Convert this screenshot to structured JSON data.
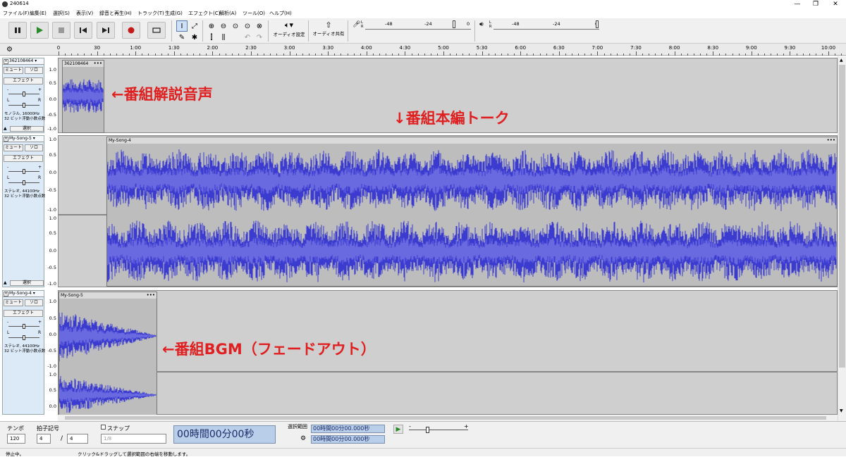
{
  "window": {
    "title": "240614",
    "controls": [
      "—",
      "❐",
      "✕"
    ]
  },
  "menu": [
    "ファイル(F)",
    "編集(E)",
    "選択(S)",
    "表示(V)",
    "録音と再生(H)",
    "トラック(T)",
    "生成(G)",
    "エフェクト(C)",
    "解析(A)",
    "ツール(O)",
    "ヘルプ(H)"
  ],
  "toolbar": {
    "audio_setup": "オーディオ設定",
    "share_audio": "オーディオ共有",
    "rec_meter_ticks": [
      "-48",
      "-24",
      "0"
    ],
    "play_meter_ticks": [
      "-48",
      "-24",
      "0"
    ],
    "meter_channels": [
      "L",
      "R"
    ]
  },
  "ruler": {
    "labels": [
      "0",
      "30",
      "1:00",
      "1:30",
      "2:00",
      "2:30",
      "3:00",
      "3:30",
      "4:00",
      "4:30",
      "5:00",
      "5:30",
      "6:00",
      "6:30",
      "7:00",
      "7:30",
      "8:00",
      "8:30",
      "9:00",
      "9:30",
      "10:00"
    ]
  },
  "tracks": [
    {
      "name": "362108464",
      "mute": "ミュート",
      "solo": "ソロ",
      "effects": "エフェクト",
      "gain": {
        "minus": "-",
        "plus": "+"
      },
      "pan": {
        "left": "L",
        "right": "R"
      },
      "info_lines": [
        "モノラル, 16000Hz",
        "32 ビット浮動小数点数"
      ],
      "select": "選択",
      "scale": [
        "1.0",
        "0.5",
        "0.0",
        "-0.5",
        "-1.0"
      ],
      "clips": [
        {
          "name": "362108464"
        }
      ]
    },
    {
      "name": "My-Song-5",
      "mute": "ミュート",
      "solo": "ソロ",
      "effects": "エフェクト",
      "gain": {
        "minus": "-",
        "plus": "+"
      },
      "pan": {
        "left": "L",
        "right": "R"
      },
      "info_lines": [
        "ステレオ, 44100Hz",
        "32 ビット浮動小数点数"
      ],
      "select": "選択",
      "scale": [
        "1.0",
        "0.5",
        "0.0",
        "-0.5",
        "-1.0"
      ],
      "clips": [
        {
          "name": "My-Song-4"
        }
      ]
    },
    {
      "name": "My-Song-4",
      "mute": "ミュート",
      "solo": "ソロ",
      "effects": "エフェクト",
      "gain": {
        "minus": "-",
        "plus": "+"
      },
      "pan": {
        "left": "L",
        "right": "R"
      },
      "info_lines": [
        "ステレオ, 44100Hz",
        "32 ビット浮動小数点数"
      ],
      "select": "選択",
      "scale": [
        "1.0",
        "0.5",
        "0.0",
        "-0.5",
        "-1.0"
      ],
      "clips": [
        {
          "name": "My-Song-5"
        }
      ]
    }
  ],
  "annotations": {
    "a1": "←番組解説音声",
    "a2": "↓番組本編トーク",
    "a3": "←番組BGM（フェードアウト）",
    "color": "#e02020"
  },
  "bottom": {
    "tempo_label": "テンポ",
    "tempo_value": "120",
    "timesig_label": "拍子記号",
    "timesig_num": "4",
    "timesig_slash": "/",
    "timesig_den": "4",
    "snap_label": "スナップ",
    "snap_value": "1/8",
    "time_display": "00時間00分00秒",
    "selection_label": "選択範囲",
    "sel_start": "00時間00分00.000秒",
    "sel_end": "00時間00分00.000秒",
    "play_speed_minus": "-",
    "play_speed_plus": "+"
  },
  "status": {
    "left": "停止中。",
    "main": "クリック&ドラッグして選択範囲の右端を移動します。"
  },
  "colors": {
    "wave": "#3b3bd0",
    "wave_light": "#6a6ae0",
    "clip_bg": "#bdbdbd",
    "track_bg": "#cfcfcf",
    "tcp_bg": "#dce9f7"
  }
}
